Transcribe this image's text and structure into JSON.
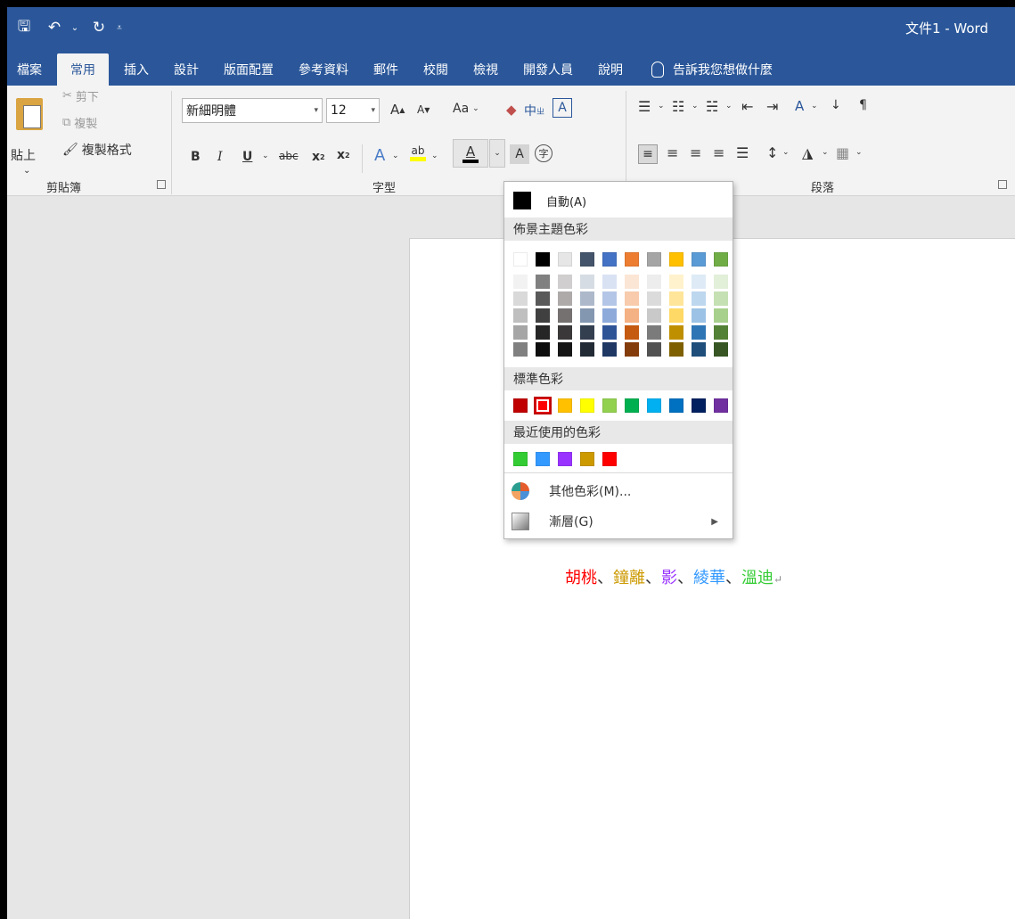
{
  "window": {
    "title": "文件1 - Word"
  },
  "qat": {
    "save_icon": "save-icon",
    "undo_icon": "undo-icon",
    "redo_icon": "redo-icon",
    "customize_icon": "customize-qat-icon"
  },
  "tabs": [
    {
      "label": "檔案",
      "active": false
    },
    {
      "label": "常用",
      "active": true
    },
    {
      "label": "插入",
      "active": false
    },
    {
      "label": "設計",
      "active": false
    },
    {
      "label": "版面配置",
      "active": false
    },
    {
      "label": "參考資料",
      "active": false
    },
    {
      "label": "郵件",
      "active": false
    },
    {
      "label": "校閱",
      "active": false
    },
    {
      "label": "檢視",
      "active": false
    },
    {
      "label": "開發人員",
      "active": false
    },
    {
      "label": "說明",
      "active": false
    }
  ],
  "tell_me": "告訴我您想做什麼",
  "clipboard": {
    "paste": "貼上",
    "cut": "剪下",
    "copy": "複製",
    "format_painter": "複製格式",
    "group_label": "剪貼簿"
  },
  "font": {
    "name": "新細明體",
    "size": "12",
    "grow": "A",
    "shrink": "A",
    "change_case": "Aa",
    "phonetic": "中",
    "border_char": "A",
    "bold": "B",
    "italic": "I",
    "underline": "U",
    "strike": "abc",
    "sub": "x",
    "sup": "x",
    "effects": "A",
    "highlight": "ab",
    "font_color": "A",
    "shading": "A",
    "enclose": "字",
    "group_label": "字型",
    "font_color_bar": "#ff0000",
    "highlight_bar": "#ffff00"
  },
  "paragraph": {
    "group_label": "段落"
  },
  "color_menu": {
    "auto_label": "自動(A)",
    "theme_header": "佈景主題色彩",
    "standard_header": "標準色彩",
    "recent_header": "最近使用的色彩",
    "more_colors": "其他色彩(M)...",
    "gradient": "漸層(G)",
    "theme_colors": [
      "#ffffff",
      "#000000",
      "#e7e6e6",
      "#44546a",
      "#4472c4",
      "#ed7d31",
      "#a5a5a5",
      "#ffc000",
      "#5b9bd5",
      "#70ad47"
    ],
    "theme_shades": [
      [
        "#f2f2f2",
        "#d9d9d9",
        "#bfbfbf",
        "#a6a6a6",
        "#808080"
      ],
      [
        "#808080",
        "#595959",
        "#404040",
        "#262626",
        "#0d0d0d"
      ],
      [
        "#d0cece",
        "#aeaaaa",
        "#757171",
        "#3a3838",
        "#171616"
      ],
      [
        "#d6dce4",
        "#adb9ca",
        "#8497b0",
        "#333f4f",
        "#222a35"
      ],
      [
        "#d9e2f3",
        "#b4c6e7",
        "#8eaadb",
        "#2f5496",
        "#1f3864"
      ],
      [
        "#fbe5d5",
        "#f7cbac",
        "#f4b183",
        "#c55a11",
        "#843c0b"
      ],
      [
        "#ededed",
        "#dbdbdb",
        "#c9c9c9",
        "#7b7b7b",
        "#525252"
      ],
      [
        "#fff2cc",
        "#fee599",
        "#ffd965",
        "#bf8f00",
        "#7f6000"
      ],
      [
        "#deebf6",
        "#bdd7ee",
        "#9cc3e5",
        "#2e75b5",
        "#1e4e79"
      ],
      [
        "#e2efd9",
        "#c5e0b3",
        "#a8d08d",
        "#538135",
        "#375623"
      ]
    ],
    "standard_colors": [
      "#c00000",
      "#ff0000",
      "#ffc000",
      "#ffff00",
      "#92d050",
      "#00b050",
      "#00b0f0",
      "#0070c0",
      "#002060",
      "#7030a0"
    ],
    "selected_standard": 1,
    "recent_colors": [
      "#33cc33",
      "#3399ff",
      "#9933ff",
      "#cc9900",
      "#ff0000"
    ]
  },
  "document": {
    "names": [
      {
        "text": "胡桃",
        "color": "#ff0000"
      },
      {
        "text": "、",
        "color": "#333333"
      },
      {
        "text": "鐘離",
        "color": "#cc9900"
      },
      {
        "text": "、",
        "color": "#333333"
      },
      {
        "text": "影",
        "color": "#9933ff"
      },
      {
        "text": "、",
        "color": "#333333"
      },
      {
        "text": "綾華",
        "color": "#3399ff"
      },
      {
        "text": "、",
        "color": "#333333"
      },
      {
        "text": "溫迪",
        "color": "#33cc33"
      }
    ],
    "paragraph_mark": "↵"
  }
}
